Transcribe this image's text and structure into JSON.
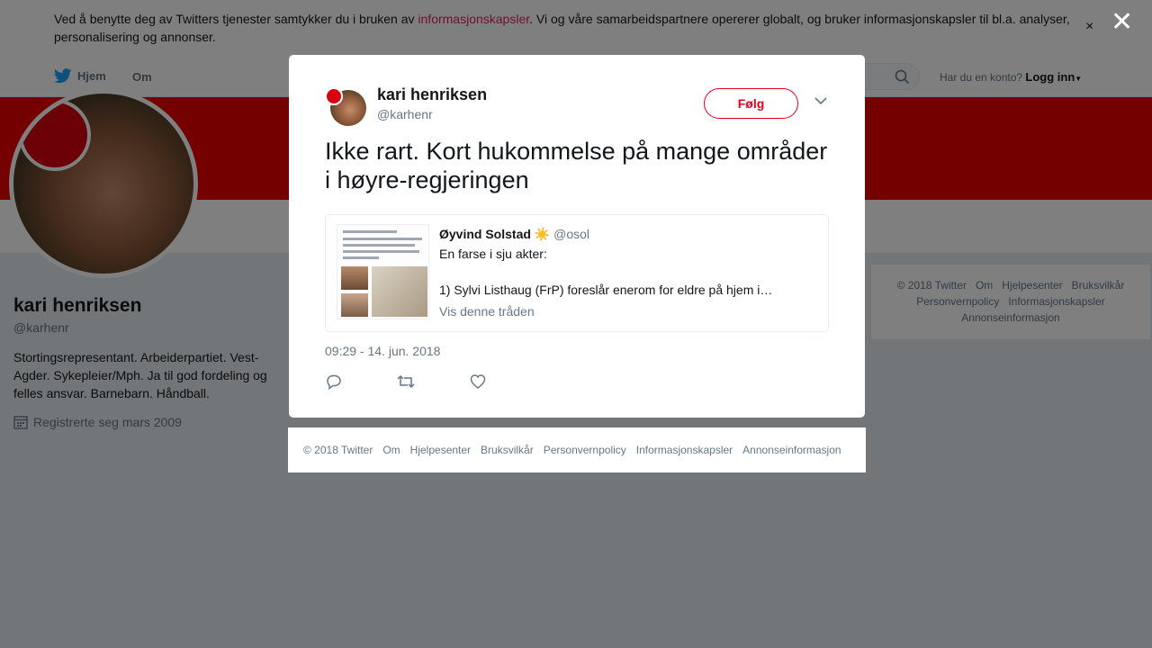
{
  "cookie_banner": {
    "text_before": "Ved å benytte deg av Twitters tjenester samtykker du i bruken av ",
    "link": "informasjonskapsler",
    "text_after": ". Vi og våre samarbeidspartnere opererer globalt, og bruker informasjonskapsler til bl.a. analyser, personalisering og annonser.",
    "close": "×"
  },
  "nav": {
    "home": "Hjem",
    "about": "Om",
    "login_prompt": "Har du en konto?",
    "login": "Logg inn"
  },
  "profile": {
    "name": "kari henriksen",
    "handle": "@karhenr",
    "bio": "Stortingsrepresentant. Arbeiderpartiet. Vest-Agder. Sykepleier/Mph. Ja til god fordeling og felles ansvar. Barnebarn. Håndball.",
    "joined": "Registrerte seg mars 2009"
  },
  "side_footer": [
    "© 2018 Twitter",
    "Om",
    "Hjelpesenter",
    "Bruksvilkår",
    "Personvernpolicy",
    "Informasjonskapsler",
    "Annonseinformasjon"
  ],
  "overlay": {
    "close": "✕"
  },
  "tweet": {
    "name": "kari henriksen",
    "handle": "@karhenr",
    "follow": "Følg",
    "text": "Ikke rart. Kort hukommelse på mange områder i høyre-regjeringen",
    "time": "09:29 - 14. jun. 2018",
    "quote": {
      "name": "Øyvind Solstad",
      "sun": "☀️",
      "handle": "@osol",
      "line1": "En farse i sju akter:",
      "line2": "1) Sylvi Listhaug (FrP) foreslår enerom for eldre på hjem i…",
      "thread": "Vis denne tråden"
    }
  },
  "modal_footer": [
    "© 2018 Twitter",
    "Om",
    "Hjelpesenter",
    "Bruksvilkår",
    "Personvernpolicy",
    "Informasjonskapsler",
    "Annonseinformasjon"
  ],
  "colors": {
    "banner": "#e80000",
    "follow": "#e3001b",
    "link": "#e0245e",
    "twitter_blue": "#1da1f2"
  },
  "icons": [
    "twitter-bird-icon",
    "search-icon",
    "calendar-icon",
    "reply-icon",
    "retweet-icon",
    "like-icon",
    "chevron-down-icon",
    "close-icon"
  ]
}
